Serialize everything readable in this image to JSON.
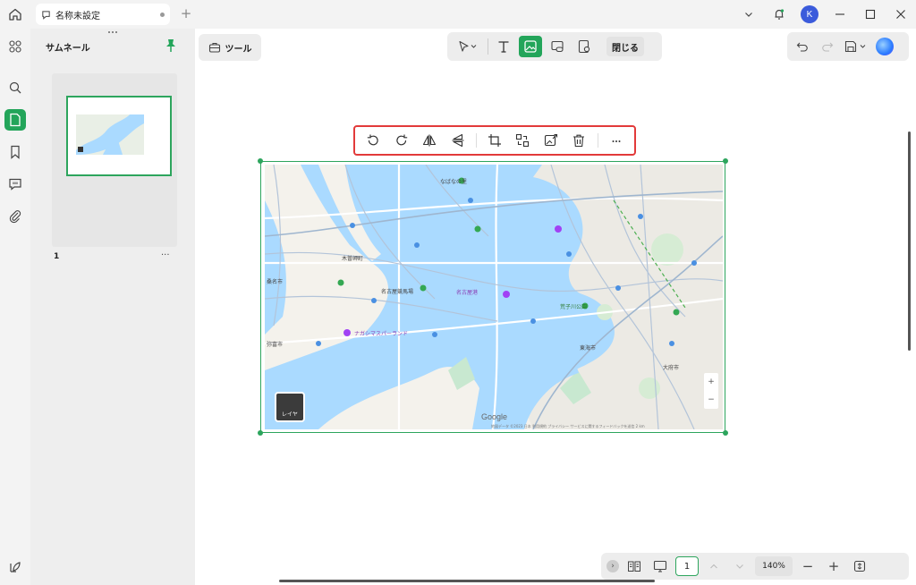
{
  "tab": {
    "title": "名称未設定"
  },
  "user": {
    "initial": "K"
  },
  "thumbnail_panel": {
    "title": "サムネール",
    "pages": [
      {
        "number": "1"
      }
    ]
  },
  "canvas": {
    "tool_button": "ツール",
    "close_button": "閉じる"
  },
  "map": {
    "labels": [
      {
        "text": "なばなの里",
        "cls": ""
      },
      {
        "text": "木曽岬町",
        "cls": ""
      },
      {
        "text": "桑名市",
        "cls": ""
      },
      {
        "text": "名古屋競馬場",
        "cls": ""
      },
      {
        "text": "弥富市",
        "cls": ""
      },
      {
        "text": "東海市",
        "cls": ""
      },
      {
        "text": "大府市",
        "cls": ""
      },
      {
        "text": "荒子川公園",
        "cls": "green"
      },
      {
        "text": "名古屋港",
        "cls": "purple"
      },
      {
        "text": "ナガシマスパーランド",
        "cls": "purple"
      }
    ],
    "brand": "Google",
    "attribution": "地図データ ©2023 日本 利用規約 プライバシー サービスに関するフィードバックを送信 2 km",
    "layer_label": "レイヤ",
    "zoom_in": "+",
    "zoom_out": "−"
  },
  "status": {
    "page": "1",
    "zoom": "140%",
    "zoom_in": "+",
    "zoom_out": "−"
  },
  "colors": {
    "accent": "#23a55a",
    "highlight": "#e23a3a",
    "water": "#aadaff"
  }
}
